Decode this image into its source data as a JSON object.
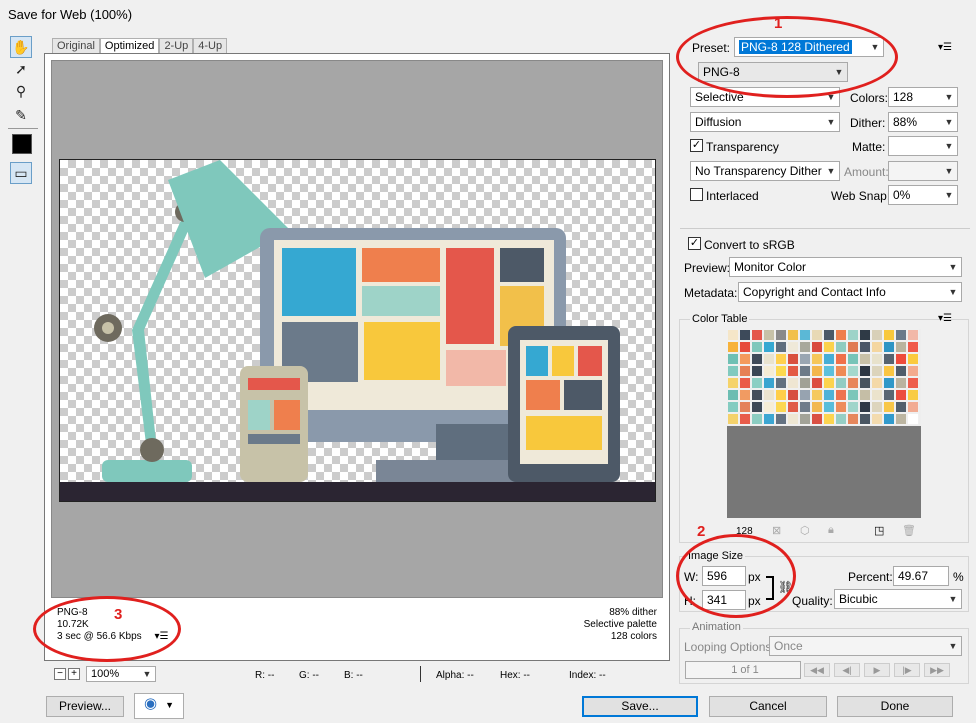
{
  "window": {
    "title": "Save for Web (100%)"
  },
  "tools": [
    {
      "name": "hand-tool-icon",
      "glyph": "✋"
    },
    {
      "name": "slice-select-tool-icon",
      "glyph": "➚"
    },
    {
      "name": "zoom-tool-icon",
      "glyph": "🔍"
    },
    {
      "name": "eyedropper-tool-icon",
      "glyph": "✎"
    }
  ],
  "tabs": [
    "Original",
    "Optimized",
    "2-Up",
    "4-Up"
  ],
  "info_left": {
    "format": "PNG-8",
    "size": "10.72K",
    "time": "3 sec @ 56.6 Kbps"
  },
  "info_right": {
    "dither": "88% dither",
    "palette": "Selective palette",
    "colors": "128 colors"
  },
  "annotations": {
    "m1": "1",
    "m2": "2",
    "m3": "3"
  },
  "status": {
    "zoom": "100%",
    "r": "R: --",
    "g": "G: --",
    "b": "B: --",
    "alpha": "Alpha: --",
    "hex": "Hex: --",
    "index": "Index: --"
  },
  "settings": {
    "preset_label": "Preset:",
    "preset_value": "PNG-8 128 Dithered",
    "format_value": "PNG-8",
    "reduction_value": "Selective",
    "colors_label": "Colors:",
    "colors_value": "128",
    "dither_algo_value": "Diffusion",
    "dither_label": "Dither:",
    "dither_value": "88%",
    "transparency_label": "Transparency",
    "matte_label": "Matte:",
    "transparency_dither_value": "No Transparency Dither",
    "amount_label": "Amount:",
    "interlaced_label": "Interlaced",
    "websnap_label": "Web Snap:",
    "websnap_value": "0%",
    "convert_label": "Convert to sRGB",
    "preview_label": "Preview:",
    "preview_value": "Monitor Color",
    "metadata_label": "Metadata:",
    "metadata_value": "Copyright and Contact Info"
  },
  "color_table": {
    "title": "Color Table",
    "count": "128",
    "swatches": [
      "#f5e6c8",
      "#3d4a5a",
      "#e4574b",
      "#c7c2a8",
      "#8a8a8a",
      "#f2c04a",
      "#5bb8d6",
      "#e8d9b5",
      "#4d5967",
      "#ef7f4d",
      "#9ed3c8",
      "#2f3a46",
      "#d8d0b8",
      "#f8c83c",
      "#6b7a8a",
      "#f2b8a8",
      "#f7b23b",
      "#e74c3c",
      "#7fc8bc",
      "#35a8d2",
      "#5f6e7e",
      "#efe9d9",
      "#a8a89c",
      "#d94a3f",
      "#fbd24c",
      "#8fcbc0",
      "#e07a52",
      "#4a5666",
      "#f4d6a0",
      "#2e95c4",
      "#b9b49e",
      "#f05a4a",
      "#6fc0b4",
      "#f49a5c",
      "#3f4b59",
      "#e9e3cf",
      "#ffd04e",
      "#d9503e",
      "#9aa6b2",
      "#f6c75a",
      "#46aed6",
      "#f06f4a",
      "#77c4b8",
      "#c8c1a8",
      "#e8e2cc",
      "#56636f",
      "#ee4b3c",
      "#fbca3e",
      "#81cabf",
      "#e68055",
      "#3a4654",
      "#f5ecd5",
      "#fcd94f",
      "#e35a44",
      "#6d7a88",
      "#f3b64c",
      "#5cc0dc",
      "#ef8a55",
      "#a4d8cd",
      "#2c3643",
      "#dcd4bc",
      "#f9c542",
      "#4f5c6a",
      "#f3aa8e",
      "#f5d36a",
      "#ea5b48",
      "#8ccfc4",
      "#3aa4d0",
      "#62707f",
      "#efe6d2",
      "#a1a196",
      "#dc4e41",
      "#fdd34e",
      "#93ccc3",
      "#e8855a",
      "#48545f",
      "#f4d9a8",
      "#3098c8",
      "#bab39f",
      "#ee5d4c",
      "#6cbdb2",
      "#f19b62",
      "#414d5b",
      "#ebe4d0",
      "#ffce4a",
      "#d74f40",
      "#97a3b0",
      "#f5c95e",
      "#4fb2d8",
      "#ee7250",
      "#7bc6ba",
      "#c5bea6",
      "#ebe3cc",
      "#5a6673",
      "#ec4d3f",
      "#f9cc44",
      "#84ccc1",
      "#e4825a",
      "#3d4856",
      "#f6edd7",
      "#fcd752",
      "#e05b47",
      "#707c8a",
      "#f2b850",
      "#58bdda",
      "#ee8c5a",
      "#a0d5ca",
      "#2e3845",
      "#ddd5bd",
      "#f8c748",
      "#525f6c",
      "#f2ac93",
      "#f4d26c",
      "#e85c4a",
      "#8bcdc2",
      "#3ca6d2",
      "#647282",
      "#eee7d3",
      "#a3a398",
      "#da5043",
      "#fcd450",
      "#96cec5",
      "#e6875c",
      "#4a5662",
      "#f3dbae",
      "#329acc",
      "#bcb5a1",
      "#ffffff"
    ]
  },
  "image_size": {
    "title": "Image Size",
    "w_label": "W:",
    "w_value": "596",
    "h_label": "H:",
    "h_value": "341",
    "unit": "px",
    "percent_label": "Percent:",
    "percent_value": "49.67",
    "percent_unit": "%",
    "quality_label": "Quality:",
    "quality_value": "Bicubic"
  },
  "animation": {
    "title": "Animation",
    "looping_label": "Looping Options:",
    "looping_value": "Once",
    "frame_counter": "1 of 1"
  },
  "buttons": {
    "preview": "Preview...",
    "save": "Save...",
    "cancel": "Cancel",
    "done": "Done"
  }
}
